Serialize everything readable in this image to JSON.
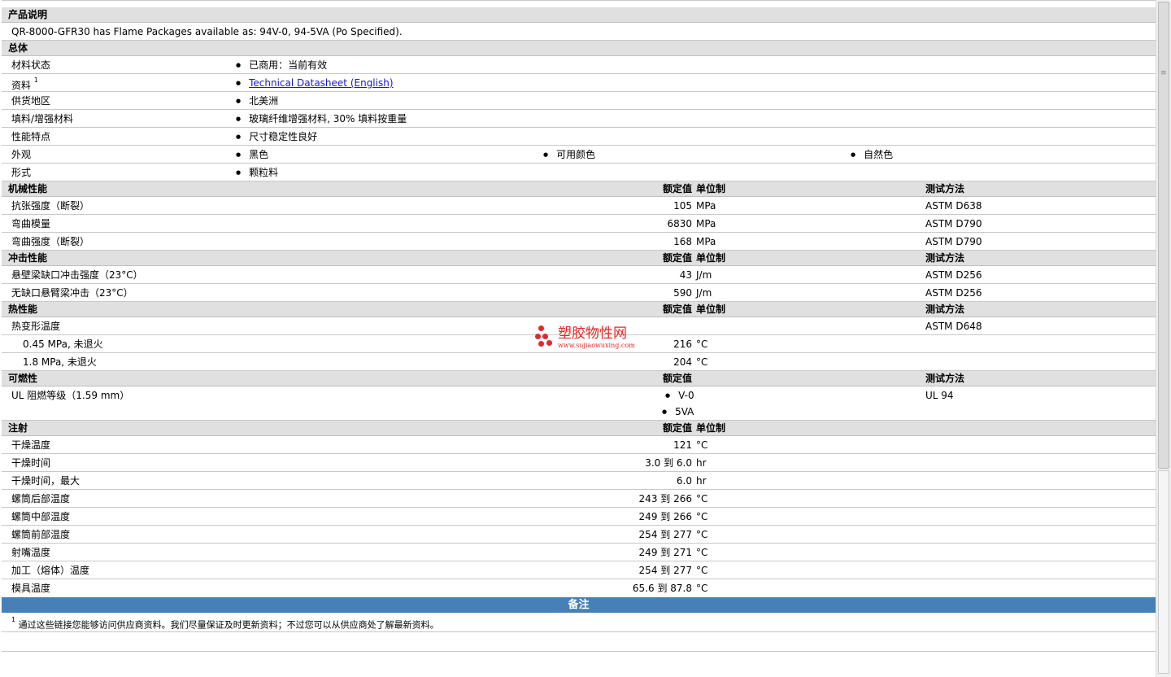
{
  "desc": {
    "header": "产品说明",
    "text": "QR-8000-GFR30 has Flame Packages available as: 94V-0, 94-5VA (Po Specified)."
  },
  "general": {
    "header": "总体",
    "rows": [
      {
        "label": "材料状态",
        "values": [
          "已商用：当前有效"
        ]
      },
      {
        "label": "资料",
        "sup": "1",
        "link": "Technical Datasheet (English)"
      },
      {
        "label": "供货地区",
        "values": [
          "北美洲"
        ]
      },
      {
        "label": "填料/增强材料",
        "values": [
          "玻璃纤维增强材料, 30% 填料按重量"
        ]
      },
      {
        "label": "性能特点",
        "values": [
          "尺寸稳定性良好"
        ]
      },
      {
        "label": "外观",
        "values": [
          "黑色",
          "可用颜色",
          "自然色"
        ]
      },
      {
        "label": "形式",
        "values": [
          "颗粒料"
        ]
      }
    ]
  },
  "columns": {
    "rated": "额定值",
    "unit": "单位制",
    "method": "测试方法"
  },
  "mechanical": {
    "header": "机械性能",
    "rows": [
      {
        "label": "抗张强度（断裂）",
        "value": "105",
        "unit": "MPa",
        "method": "ASTM D638"
      },
      {
        "label": "弯曲模量",
        "value": "6830",
        "unit": "MPa",
        "method": "ASTM D790"
      },
      {
        "label": "弯曲强度（断裂）",
        "value": "168",
        "unit": "MPa",
        "method": "ASTM D790"
      }
    ]
  },
  "impact": {
    "header": "冲击性能",
    "rows": [
      {
        "label": "悬壁梁缺口冲击强度（23°C）",
        "value": "43",
        "unit": "J/m",
        "method": "ASTM D256"
      },
      {
        "label": "无缺口悬臂梁冲击（23°C）",
        "value": "590",
        "unit": "J/m",
        "method": "ASTM D256"
      }
    ]
  },
  "thermal": {
    "header": "热性能",
    "rows": [
      {
        "label": "热变形温度",
        "value": "",
        "unit": "",
        "method": "ASTM D648"
      },
      {
        "label": "0.45 MPa, 未退火",
        "value": "216",
        "unit": "°C",
        "method": ""
      },
      {
        "label": "1.8 MPa, 未退火",
        "value": "204",
        "unit": "°C",
        "method": ""
      }
    ]
  },
  "flammability": {
    "header": "可燃性",
    "label": "UL 阻燃等级（1.59 mm）",
    "values": [
      "V-0",
      "5VA"
    ],
    "method": "UL 94"
  },
  "injection": {
    "header": "注射",
    "rows": [
      {
        "label": "干燥温度",
        "value": "121",
        "unit": "°C"
      },
      {
        "label": "干燥时间",
        "value": "3.0 到  6.0",
        "unit": "hr"
      },
      {
        "label": "干燥时间，最大",
        "value": "6.0",
        "unit": "hr"
      },
      {
        "label": "螺筒后部温度",
        "value": "243 到  266",
        "unit": "°C"
      },
      {
        "label": "螺筒中部温度",
        "value": "249 到  266",
        "unit": "°C"
      },
      {
        "label": "螺筒前部温度",
        "value": "254 到  277",
        "unit": "°C"
      },
      {
        "label": "射嘴温度",
        "value": "249 到  271",
        "unit": "°C"
      },
      {
        "label": "加工（熔体）温度",
        "value": "254 到  277",
        "unit": "°C"
      },
      {
        "label": "模具温度",
        "value": "65.6 到  87.8",
        "unit": "°C"
      }
    ]
  },
  "notes": {
    "header": "备注",
    "sup": "1",
    "text": "通过这些链接您能够访问供应商资料。我们尽量保证及时更新资料；不过您可以从供应商处了解最新资料。"
  },
  "watermark": {
    "title": "塑胶物性网",
    "url": "www.sujiaowuxing.com"
  }
}
